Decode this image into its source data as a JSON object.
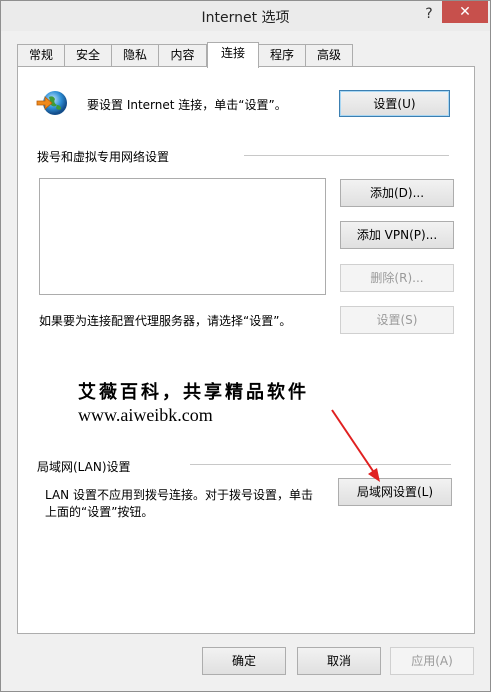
{
  "window": {
    "title": "Internet 选项",
    "help": "?",
    "close": "✕"
  },
  "tabs": [
    {
      "label": "常规"
    },
    {
      "label": "安全"
    },
    {
      "label": "隐私"
    },
    {
      "label": "内容"
    },
    {
      "label": "连接",
      "active": true
    },
    {
      "label": "程序"
    },
    {
      "label": "高级"
    }
  ],
  "setup": {
    "text": "要设置 Internet 连接，单击“设置”。",
    "button": "设置(U)"
  },
  "dialup": {
    "heading": "拨号和虚拟专用网络设置",
    "add_button": "添加(D)...",
    "add_vpn_button": "添加 VPN(P)...",
    "remove_button": "删除(R)...",
    "settings_button": "设置(S)",
    "proxy_hint": "如果要为连接配置代理服务器，请选择“设置”。"
  },
  "watermark": {
    "line1": "艾薇百科，共享精品软件",
    "line2": "www.aiweibk.com"
  },
  "lan": {
    "heading": "局域网(LAN)设置",
    "description_line1": "LAN 设置不应用到拨号连接。对于拨号设置，单击",
    "description_line2": "上面的“设置”按钮。",
    "button": "局域网设置(L)"
  },
  "footer": {
    "ok": "确定",
    "cancel": "取消",
    "apply": "应用(A)"
  },
  "colors": {
    "close_button": "#c7504c",
    "annotation_arrow": "#e02020"
  }
}
